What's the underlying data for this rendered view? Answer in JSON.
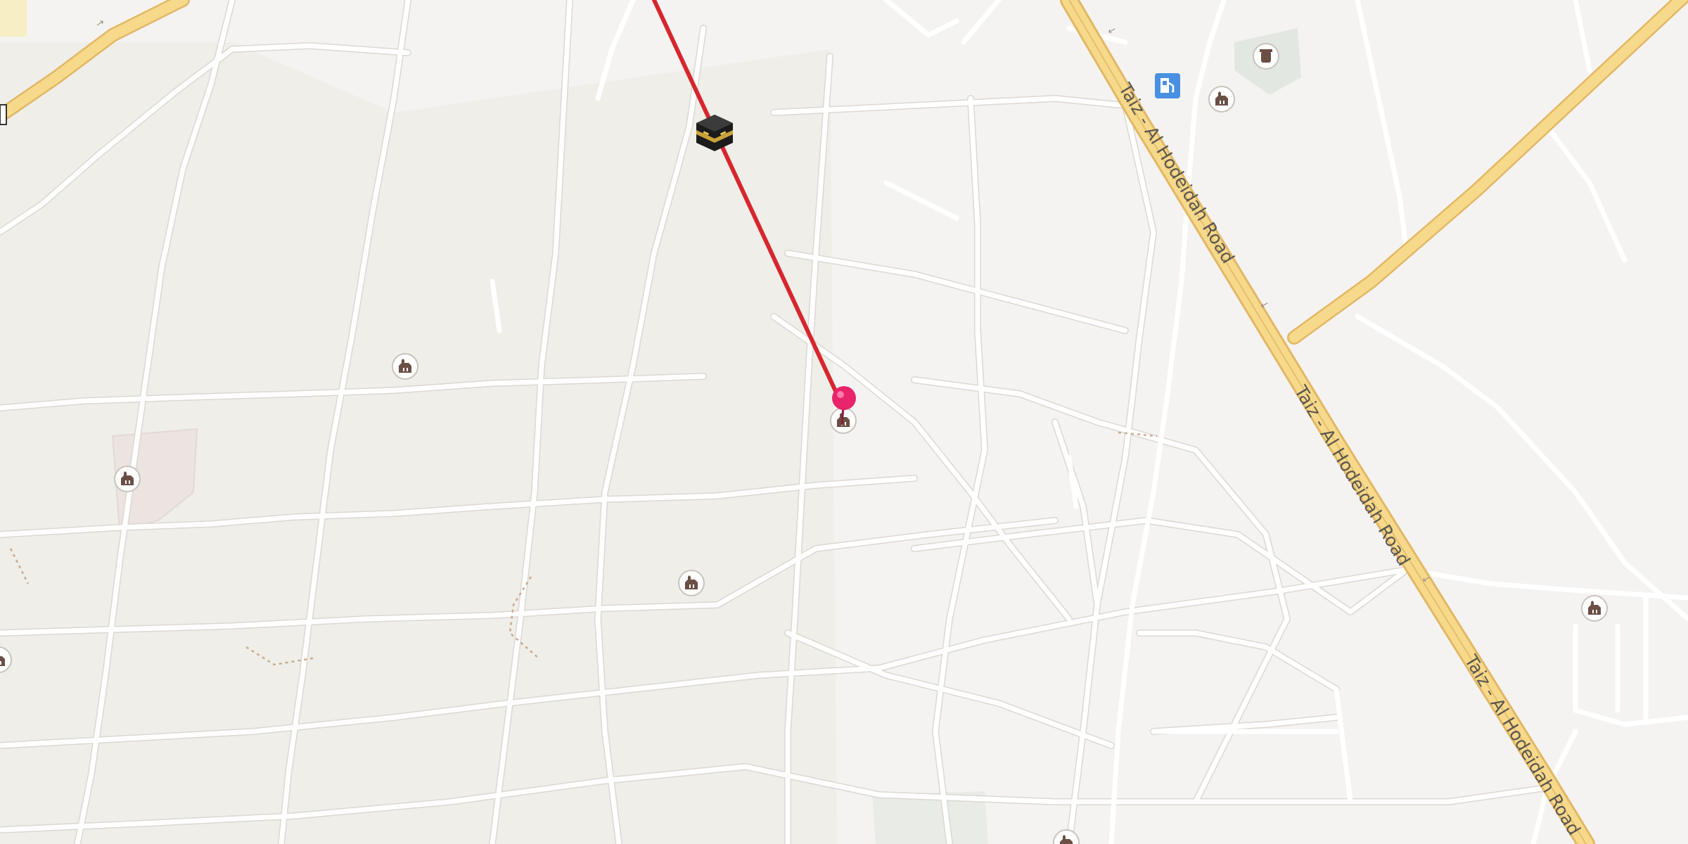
{
  "map": {
    "road_labels": [
      "Taiz - Al Hodeidah Road",
      "Taiz - Al Hodeidah Road",
      "Taiz - Al Hodeidah Road"
    ],
    "colors": {
      "background": "#f5f3f1",
      "block_fill": "#efeeea",
      "street": "#ffffff",
      "street_edge": "#dcd8d2",
      "highway_fill": "#f7d98b",
      "highway_edge": "#e2b765",
      "route_line": "#d7262e",
      "pin": "#e8246a",
      "mosque_icon": "#6b4f45",
      "fuel_icon": "#4a90e2",
      "green_area": "#dfe6df",
      "compound_fill": "#ece4e0"
    },
    "icons": {
      "origin_marker": "kaaba-icon",
      "destination_marker": "map-pin-icon",
      "mosque": "mosque-icon",
      "fuel_station": "fuel-station-icon",
      "cemetery": "cemetery-icon"
    }
  }
}
